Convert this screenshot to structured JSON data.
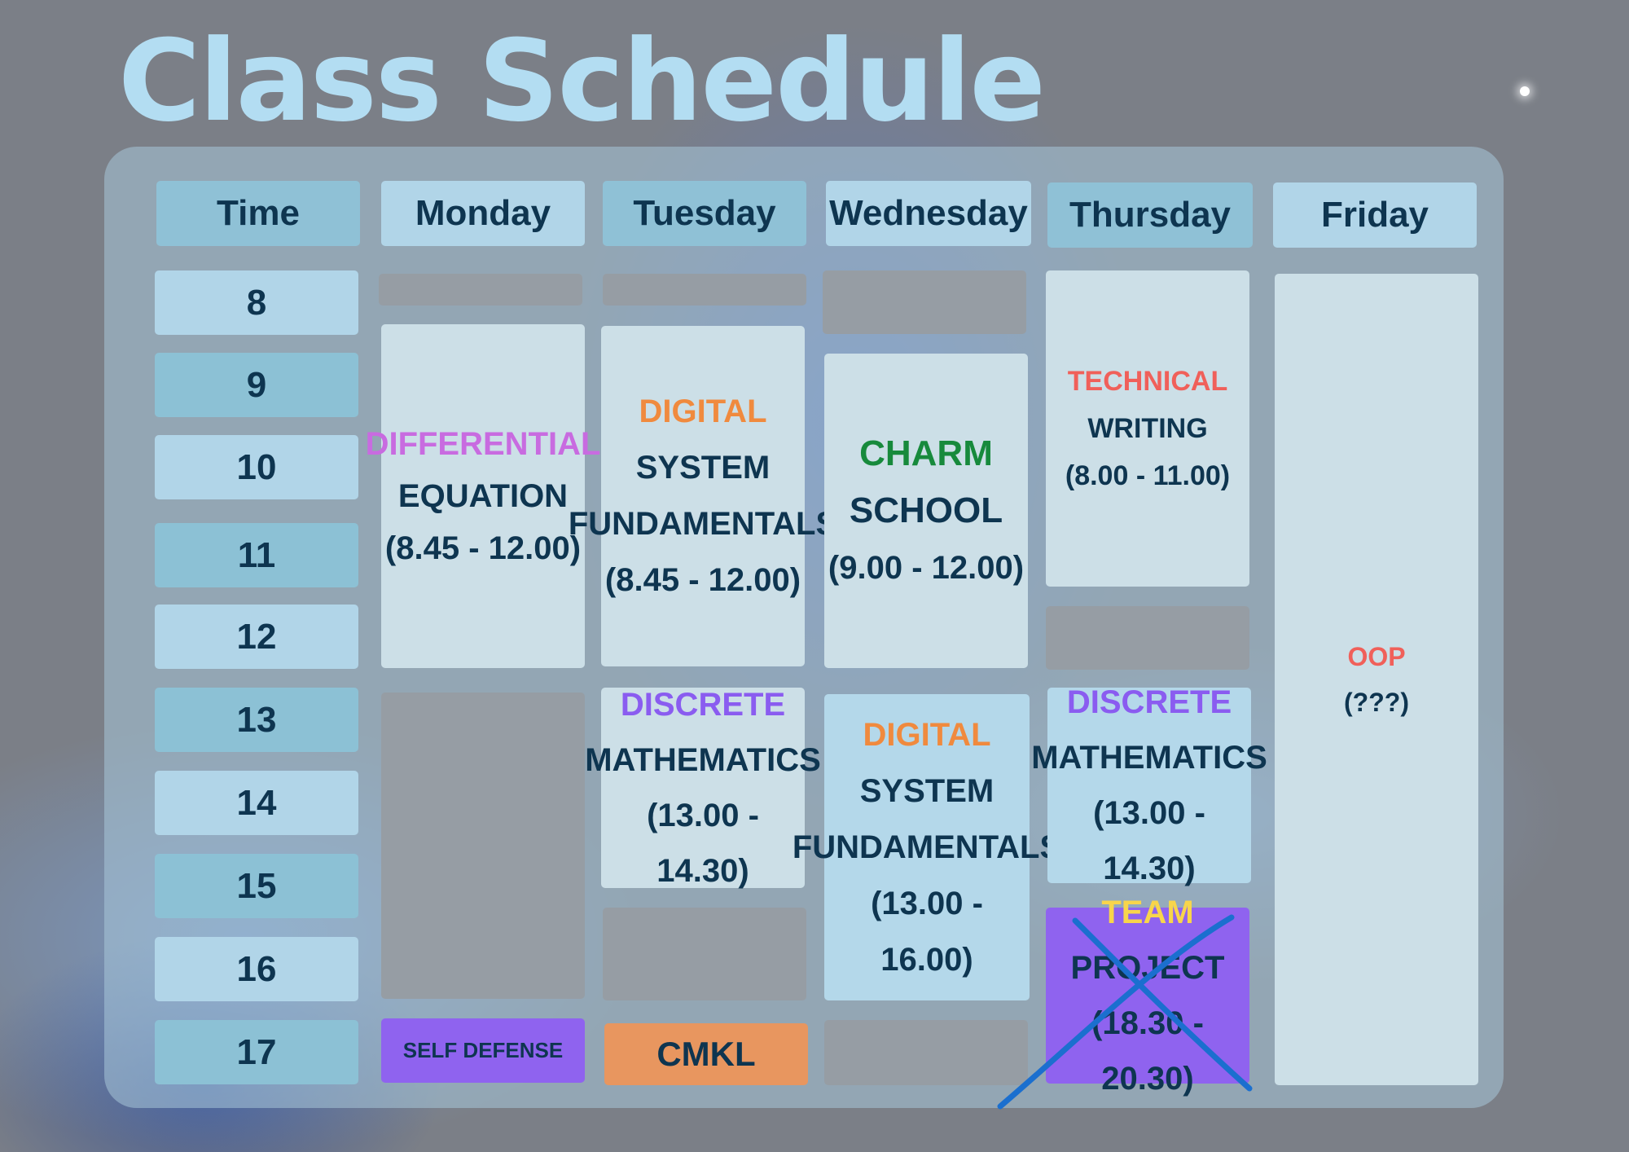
{
  "title": "Class Schedule",
  "headers": [
    "Time",
    "Monday",
    "Tuesday",
    "Wednesday",
    "Thursday",
    "Friday"
  ],
  "times": [
    "8",
    "9",
    "10",
    "11",
    "12",
    "13",
    "14",
    "15",
    "16",
    "17"
  ],
  "courses": {
    "differential": {
      "name1": "DIFFERENTIAL",
      "name2": "EQUATION",
      "time": "(8.45 - 12.00)"
    },
    "digital_tue": {
      "name1": "DIGITAL",
      "name2": "SYSTEM",
      "name3": "FUNDAMENTALS",
      "time": "(8.45 - 12.00)"
    },
    "charm": {
      "name1": "CHARM",
      "name2": "SCHOOL",
      "time": "(9.00 - 12.00)"
    },
    "technical": {
      "name1": "TECHNICAL",
      "name2": "WRITING",
      "time": "(8.00 - 11.00)"
    },
    "oop": {
      "name1": "OOP",
      "time": "(???)"
    },
    "discrete_tue": {
      "name1": "DISCRETE",
      "name2": "MATHEMATICS",
      "time": "(13.00 - 14.30)"
    },
    "digital_wed": {
      "name1": "DIGITAL",
      "name2": "SYSTEM",
      "name3": "FUNDAMENTALS",
      "time": "(13.00 - 16.00)"
    },
    "discrete_thu": {
      "name1": "DISCRETE",
      "name2": "MATHEMATICS",
      "time": "(13.00 - 14.30)"
    },
    "team": {
      "name1": "TEAM",
      "name2": "PROJECT",
      "time": "(18.30 - 20.30)"
    },
    "self_defense": {
      "name1": "SELF DEFENSE"
    },
    "cmkl": {
      "name1": "CMKL"
    }
  },
  "colors": {
    "title": "#b3ddf2",
    "text_dark": "#0e3550",
    "pink": "#c86be0",
    "orange": "#f08a3e",
    "green": "#178a3c",
    "red": "#f0605a",
    "purple": "#8a5cf0",
    "yellow": "#f8d54b",
    "purple_box": "#8f63ef",
    "orange_box": "#e8965f",
    "cross": "#1b6fcf"
  }
}
